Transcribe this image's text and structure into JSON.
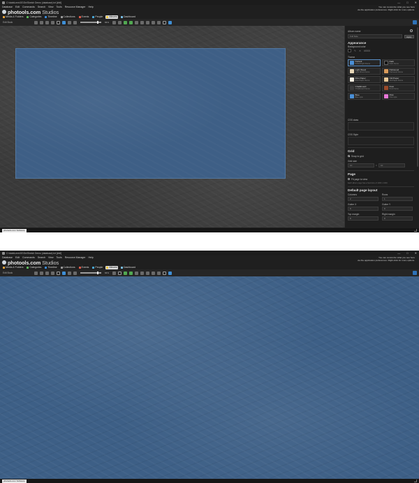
{
  "window": {
    "title": "C:\\data\\Lens\\GGGn\\Sketch Demo (database).txt  [###]",
    "controls": [
      "—",
      "□",
      "✕"
    ]
  },
  "menu": [
    "Database",
    "Edit",
    "Commands",
    "Search",
    "View",
    "Tools",
    "Resource Manager",
    "Help"
  ],
  "promo": {
    "line1": "You can customize what you see here",
    "line2": "via the application preferences. Right-click for more options."
  },
  "logo": {
    "brand": "photools",
    "domain": ".com",
    "product": " Studios"
  },
  "nav_tabs": [
    {
      "label": "Media & Folders",
      "color": "#e8a23a",
      "active": false
    },
    {
      "label": "Categories",
      "color": "#5cb85c",
      "active": false
    },
    {
      "label": "Timeline",
      "color": "#3a8ad8",
      "active": false
    },
    {
      "label": "Collections",
      "color": "#9a9a9a",
      "active": false
    },
    {
      "label": "Events",
      "color": "#e05a4a",
      "active": false
    },
    {
      "label": "People",
      "color": "#4aa8d8",
      "active": false
    },
    {
      "label": "Albums",
      "color": "#e8c23a",
      "active": true
    },
    {
      "label": "Dashboard",
      "color": "#7ac0e8",
      "active": false
    }
  ],
  "toolbar": {
    "subtitle": "Edit Book",
    "zoom": "84%"
  },
  "status_tab": "photools.com Software",
  "panel": {
    "album_name_label": "Album name",
    "album_name_value": "Full Side",
    "apply": "Apply",
    "appearance": "Appearance",
    "bg_color_label": "Background color",
    "bg_color_hex": "#0000",
    "theme_label": "Theme",
    "themes": [
      {
        "name": "Default",
        "desc": "Default light theme",
        "color": "#4a8fd6",
        "selected": true
      },
      {
        "name": "Dark",
        "desc": "Dark theme",
        "color": "#1a1a1a",
        "selected": false
      },
      {
        "name": "Light Wood",
        "desc": "Light Wood theme",
        "color": "#e8d8b8",
        "selected": false
      },
      {
        "name": "Parkwood",
        "desc": "Parkwood theme",
        "color": "#d89a5a",
        "selected": false
      },
      {
        "name": "Rice Paper",
        "desc": "Rice Paper theme",
        "color": "#f4ede0",
        "selected": false
      },
      {
        "name": "Old Paper",
        "desc": "Old Paper theme",
        "color": "#e8c898",
        "selected": false
      },
      {
        "name": "Chalkboard",
        "desc": "Chalkboard theme",
        "color": "#3a3a3a",
        "selected": false
      },
      {
        "name": "Rust",
        "desc": "Rust theme",
        "color": "#9a4a2a",
        "selected": false
      },
      {
        "name": "Blue",
        "desc": "Blue style",
        "color": "#4a8fd6",
        "selected": false
      },
      {
        "name": "Pink",
        "desc": "Pink style",
        "color": "#e878d8",
        "selected": false
      }
    ],
    "css_class_label": "CSS class",
    "css_style_label": "CSS Style",
    "grid_head": "Grid",
    "snap_to_grid": "Snap to grid",
    "grid_size_label": "Grid size",
    "grid_w": "10",
    "grid_h": "10",
    "page_head": "Page",
    "fit_page": "Fit page to view",
    "page_hint": "Each album page has a fixed size of 1000 x 1000",
    "layout_head": "Default page layout",
    "columns_label": "Columns",
    "columns_value": "2",
    "rows_label": "Rows",
    "rows_value": "1",
    "gutter_x_label": "Gutter X",
    "gutter_x_value": "8",
    "gutter_y_label": "Gutter Y",
    "gutter_y_value": "8",
    "top_margin_label": "Top margin",
    "top_margin_value": "8",
    "right_margin_label": "Right margin",
    "right_margin_value": "8"
  }
}
